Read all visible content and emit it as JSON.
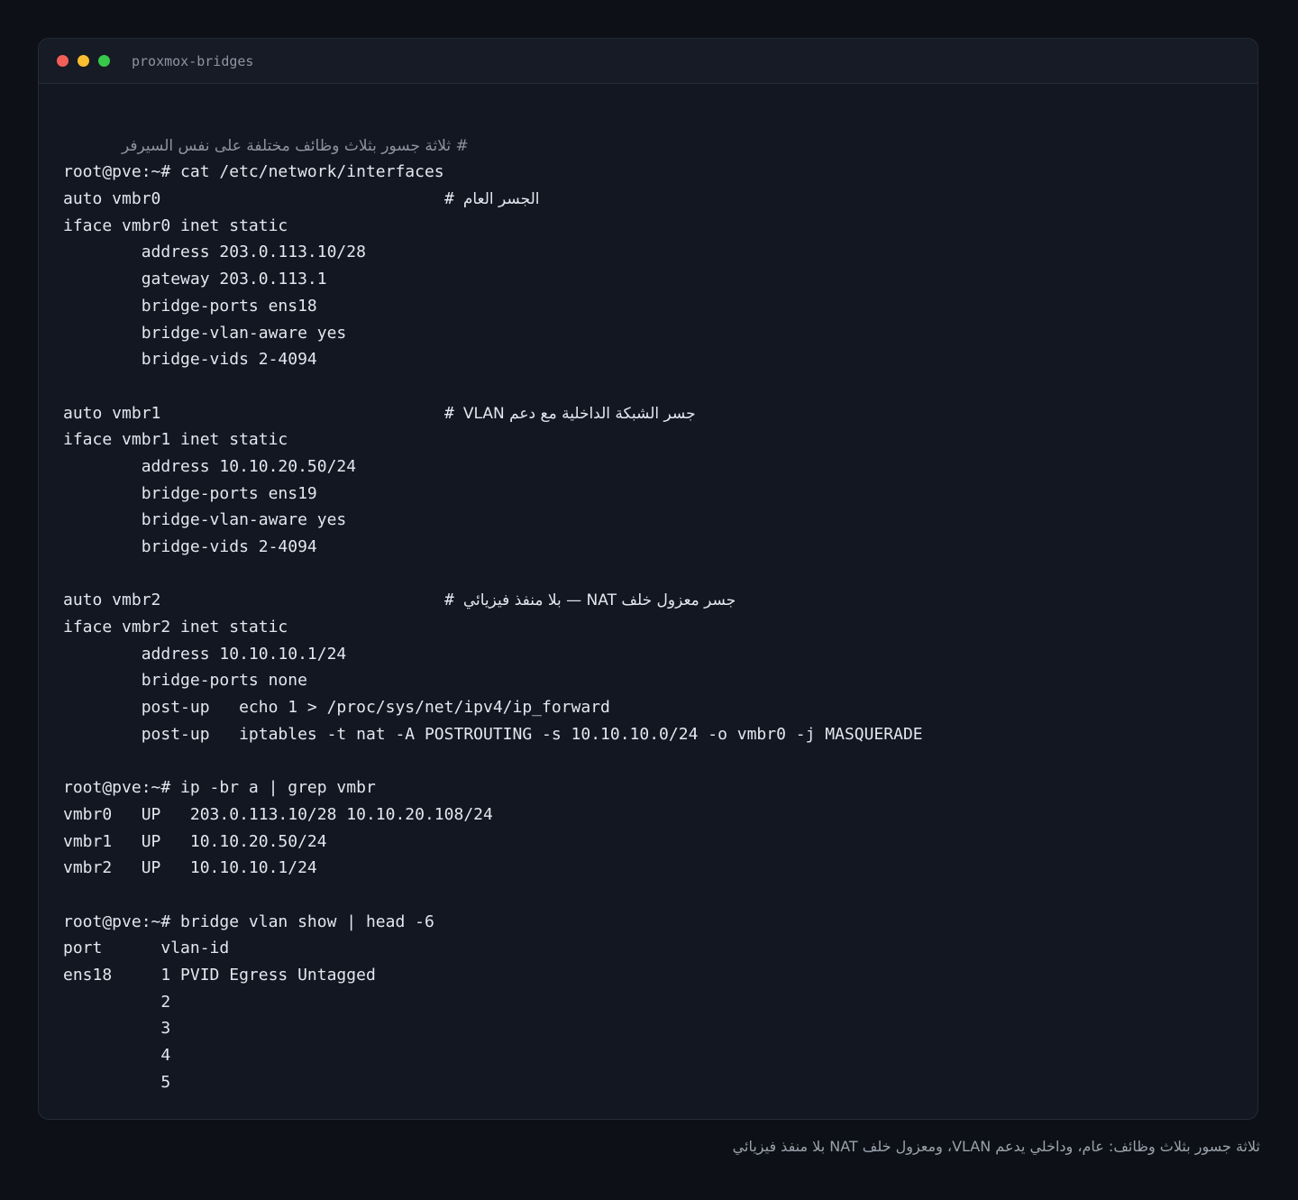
{
  "window": {
    "title": "proxmox-bridges"
  },
  "terminal": {
    "header_comment": "# ثلاثة جسور بثلاث وظائف مختلفة على نفس السيرفر",
    "lines": [
      {
        "text": ""
      },
      {
        "text": "root@pve:~# cat /etc/network/interfaces"
      },
      {
        "text": "auto vmbr0",
        "comment": "الجسر العام"
      },
      {
        "text": "iface vmbr0 inet static"
      },
      {
        "text": "        address 203.0.113.10/28"
      },
      {
        "text": "        gateway 203.0.113.1"
      },
      {
        "text": "        bridge-ports ens18"
      },
      {
        "text": "        bridge-vlan-aware yes"
      },
      {
        "text": "        bridge-vids 2-4094"
      },
      {
        "text": ""
      },
      {
        "text": "auto vmbr1",
        "comment": "جسر الشبكة الداخلية مع دعم VLAN"
      },
      {
        "text": "iface vmbr1 inet static"
      },
      {
        "text": "        address 10.10.20.50/24"
      },
      {
        "text": "        bridge-ports ens19"
      },
      {
        "text": "        bridge-vlan-aware yes"
      },
      {
        "text": "        bridge-vids 2-4094"
      },
      {
        "text": ""
      },
      {
        "text": "auto vmbr2",
        "comment": "جسر معزول خلف NAT — بلا منفذ فيزيائي"
      },
      {
        "text": "iface vmbr2 inet static"
      },
      {
        "text": "        address 10.10.10.1/24"
      },
      {
        "text": "        bridge-ports none"
      },
      {
        "text": "        post-up   echo 1 > /proc/sys/net/ipv4/ip_forward"
      },
      {
        "text": "        post-up   iptables -t nat -A POSTROUTING -s 10.10.10.0/24 -o vmbr0 -j MASQUERADE"
      },
      {
        "text": ""
      },
      {
        "text": "root@pve:~# ip -br a | grep vmbr"
      },
      {
        "text": "vmbr0   UP   203.0.113.10/28 10.10.20.108/24"
      },
      {
        "text": "vmbr1   UP   10.10.20.50/24"
      },
      {
        "text": "vmbr2   UP   10.10.10.1/24"
      },
      {
        "text": ""
      },
      {
        "text": "root@pve:~# bridge vlan show | head -6"
      },
      {
        "text": "port      vlan-id"
      },
      {
        "text": "ens18     1 PVID Egress Untagged"
      },
      {
        "text": "          2"
      },
      {
        "text": "          3"
      },
      {
        "text": "          4"
      },
      {
        "text": "          5"
      }
    ]
  },
  "caption": "ثلاثة جسور بثلاث وظائف: عام، وداخلي يدعم VLAN، ومعزول خلف NAT بلا منفذ فيزيائي"
}
